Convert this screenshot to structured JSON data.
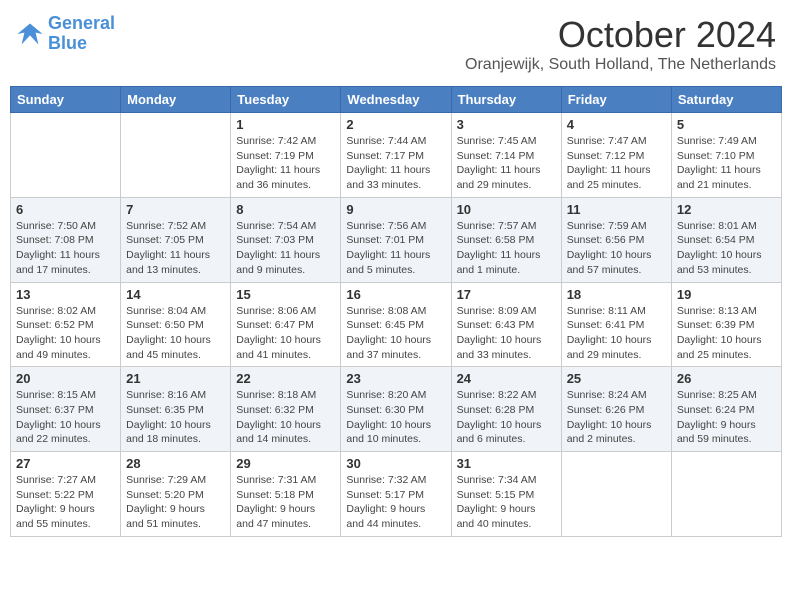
{
  "header": {
    "logo_line1": "General",
    "logo_line2": "Blue",
    "month_title": "October 2024",
    "subtitle": "Oranjewijk, South Holland, The Netherlands"
  },
  "days_of_week": [
    "Sunday",
    "Monday",
    "Tuesday",
    "Wednesday",
    "Thursday",
    "Friday",
    "Saturday"
  ],
  "weeks": [
    [
      {
        "day": "",
        "info": ""
      },
      {
        "day": "",
        "info": ""
      },
      {
        "day": "1",
        "info": "Sunrise: 7:42 AM\nSunset: 7:19 PM\nDaylight: 11 hours\nand 36 minutes."
      },
      {
        "day": "2",
        "info": "Sunrise: 7:44 AM\nSunset: 7:17 PM\nDaylight: 11 hours\nand 33 minutes."
      },
      {
        "day": "3",
        "info": "Sunrise: 7:45 AM\nSunset: 7:14 PM\nDaylight: 11 hours\nand 29 minutes."
      },
      {
        "day": "4",
        "info": "Sunrise: 7:47 AM\nSunset: 7:12 PM\nDaylight: 11 hours\nand 25 minutes."
      },
      {
        "day": "5",
        "info": "Sunrise: 7:49 AM\nSunset: 7:10 PM\nDaylight: 11 hours\nand 21 minutes."
      }
    ],
    [
      {
        "day": "6",
        "info": "Sunrise: 7:50 AM\nSunset: 7:08 PM\nDaylight: 11 hours\nand 17 minutes."
      },
      {
        "day": "7",
        "info": "Sunrise: 7:52 AM\nSunset: 7:05 PM\nDaylight: 11 hours\nand 13 minutes."
      },
      {
        "day": "8",
        "info": "Sunrise: 7:54 AM\nSunset: 7:03 PM\nDaylight: 11 hours\nand 9 minutes."
      },
      {
        "day": "9",
        "info": "Sunrise: 7:56 AM\nSunset: 7:01 PM\nDaylight: 11 hours\nand 5 minutes."
      },
      {
        "day": "10",
        "info": "Sunrise: 7:57 AM\nSunset: 6:58 PM\nDaylight: 11 hours\nand 1 minute."
      },
      {
        "day": "11",
        "info": "Sunrise: 7:59 AM\nSunset: 6:56 PM\nDaylight: 10 hours\nand 57 minutes."
      },
      {
        "day": "12",
        "info": "Sunrise: 8:01 AM\nSunset: 6:54 PM\nDaylight: 10 hours\nand 53 minutes."
      }
    ],
    [
      {
        "day": "13",
        "info": "Sunrise: 8:02 AM\nSunset: 6:52 PM\nDaylight: 10 hours\nand 49 minutes."
      },
      {
        "day": "14",
        "info": "Sunrise: 8:04 AM\nSunset: 6:50 PM\nDaylight: 10 hours\nand 45 minutes."
      },
      {
        "day": "15",
        "info": "Sunrise: 8:06 AM\nSunset: 6:47 PM\nDaylight: 10 hours\nand 41 minutes."
      },
      {
        "day": "16",
        "info": "Sunrise: 8:08 AM\nSunset: 6:45 PM\nDaylight: 10 hours\nand 37 minutes."
      },
      {
        "day": "17",
        "info": "Sunrise: 8:09 AM\nSunset: 6:43 PM\nDaylight: 10 hours\nand 33 minutes."
      },
      {
        "day": "18",
        "info": "Sunrise: 8:11 AM\nSunset: 6:41 PM\nDaylight: 10 hours\nand 29 minutes."
      },
      {
        "day": "19",
        "info": "Sunrise: 8:13 AM\nSunset: 6:39 PM\nDaylight: 10 hours\nand 25 minutes."
      }
    ],
    [
      {
        "day": "20",
        "info": "Sunrise: 8:15 AM\nSunset: 6:37 PM\nDaylight: 10 hours\nand 22 minutes."
      },
      {
        "day": "21",
        "info": "Sunrise: 8:16 AM\nSunset: 6:35 PM\nDaylight: 10 hours\nand 18 minutes."
      },
      {
        "day": "22",
        "info": "Sunrise: 8:18 AM\nSunset: 6:32 PM\nDaylight: 10 hours\nand 14 minutes."
      },
      {
        "day": "23",
        "info": "Sunrise: 8:20 AM\nSunset: 6:30 PM\nDaylight: 10 hours\nand 10 minutes."
      },
      {
        "day": "24",
        "info": "Sunrise: 8:22 AM\nSunset: 6:28 PM\nDaylight: 10 hours\nand 6 minutes."
      },
      {
        "day": "25",
        "info": "Sunrise: 8:24 AM\nSunset: 6:26 PM\nDaylight: 10 hours\nand 2 minutes."
      },
      {
        "day": "26",
        "info": "Sunrise: 8:25 AM\nSunset: 6:24 PM\nDaylight: 9 hours\nand 59 minutes."
      }
    ],
    [
      {
        "day": "27",
        "info": "Sunrise: 7:27 AM\nSunset: 5:22 PM\nDaylight: 9 hours\nand 55 minutes."
      },
      {
        "day": "28",
        "info": "Sunrise: 7:29 AM\nSunset: 5:20 PM\nDaylight: 9 hours\nand 51 minutes."
      },
      {
        "day": "29",
        "info": "Sunrise: 7:31 AM\nSunset: 5:18 PM\nDaylight: 9 hours\nand 47 minutes."
      },
      {
        "day": "30",
        "info": "Sunrise: 7:32 AM\nSunset: 5:17 PM\nDaylight: 9 hours\nand 44 minutes."
      },
      {
        "day": "31",
        "info": "Sunrise: 7:34 AM\nSunset: 5:15 PM\nDaylight: 9 hours\nand 40 minutes."
      },
      {
        "day": "",
        "info": ""
      },
      {
        "day": "",
        "info": ""
      }
    ]
  ]
}
